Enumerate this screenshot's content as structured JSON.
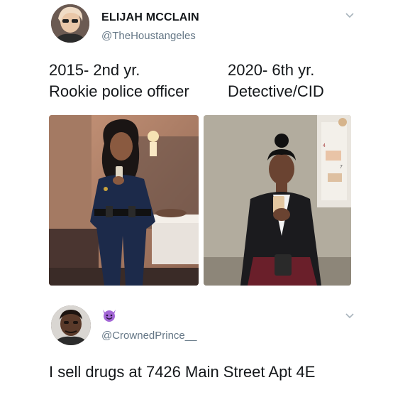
{
  "tweet1": {
    "display_name": "ELIJAH MCCLAIN",
    "handle": "@TheHoustangeles",
    "left_col": {
      "line1": "2015- 2nd yr.",
      "line2": "Rookie police officer"
    },
    "right_col": {
      "line1": "2020- 6th yr.",
      "line2": "Detective/CID"
    },
    "icons": {
      "avatar": "profile-photo",
      "menu": "chevron-down-icon"
    }
  },
  "tweet2": {
    "display_name_emoji": "smiling-devil-emoji",
    "handle": "@CrownedPrince__",
    "text": "I sell drugs at 7426 Main Street Apt 4E",
    "icons": {
      "avatar": "profile-photo",
      "menu": "chevron-down-icon"
    }
  },
  "colors": {
    "text": "#14171a",
    "secondary": "#657786",
    "emoji_purple": "#a366d6"
  }
}
